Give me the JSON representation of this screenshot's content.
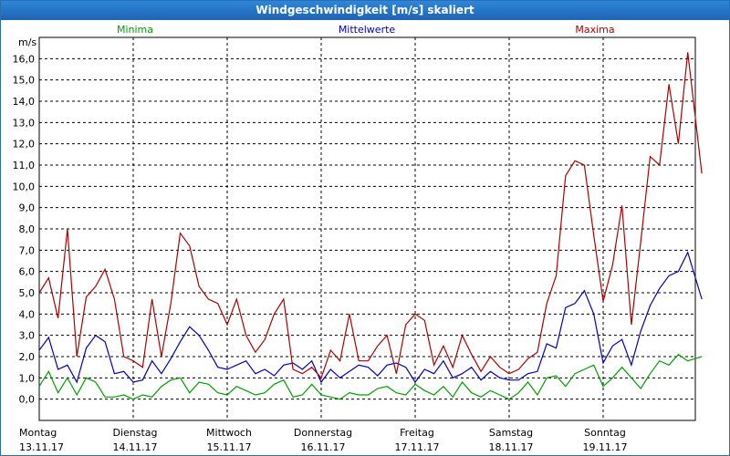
{
  "window": {
    "title": "Windgeschwindigkeit [m/s] skaliert"
  },
  "chart_data": {
    "type": "line",
    "ylabel": "m/s",
    "ylim": [
      -1,
      17
    ],
    "yticks": [
      "0,0",
      "1,0",
      "2,0",
      "3,0",
      "4,0",
      "5,0",
      "6,0",
      "7,0",
      "8,0",
      "9,0",
      "10,0",
      "11,0",
      "12,0",
      "13,0",
      "14,0",
      "15,0",
      "16,0"
    ],
    "grid": true,
    "legend_position": "top",
    "days": [
      {
        "name": "Montag",
        "date": "13.11.17"
      },
      {
        "name": "Dienstag",
        "date": "14.11.17"
      },
      {
        "name": "Mittwoch",
        "date": "15.11.17"
      },
      {
        "name": "Donnerstag",
        "date": "16.11.17"
      },
      {
        "name": "Freitag",
        "date": "17.11.17"
      },
      {
        "name": "Samstag",
        "date": "18.11.17"
      },
      {
        "name": "Sonntag",
        "date": "19.11.17"
      }
    ],
    "x_days": [
      0,
      0.1,
      0.2,
      0.3,
      0.4,
      0.5,
      0.6,
      0.7,
      0.8,
      0.9,
      1,
      1.1,
      1.2,
      1.3,
      1.4,
      1.5,
      1.6,
      1.7,
      1.8,
      1.9,
      2,
      2.1,
      2.2,
      2.3,
      2.4,
      2.5,
      2.6,
      2.7,
      2.8,
      2.9,
      3,
      3.1,
      3.2,
      3.3,
      3.4,
      3.5,
      3.6,
      3.7,
      3.8,
      3.9,
      4,
      4.1,
      4.2,
      4.3,
      4.4,
      4.5,
      4.6,
      4.7,
      4.8,
      4.9,
      5,
      5.1,
      5.2,
      5.3,
      5.4,
      5.5,
      5.6,
      5.7,
      5.8,
      5.9,
      6,
      6.1,
      6.2,
      6.3,
      6.4,
      6.5,
      6.6,
      6.7,
      6.8,
      6.9,
      7.05
    ],
    "series": [
      {
        "name": "Minima",
        "color": "#00a000",
        "values": [
          0.6,
          1.3,
          0.3,
          1.0,
          0.2,
          1.0,
          0.8,
          0.1,
          0.1,
          0.2,
          0.0,
          0.2,
          0.1,
          0.6,
          0.9,
          1.0,
          0.3,
          0.8,
          0.7,
          0.3,
          0.2,
          0.6,
          0.4,
          0.2,
          0.3,
          0.7,
          0.9,
          0.1,
          0.2,
          0.7,
          0.2,
          0.1,
          0.0,
          0.3,
          0.2,
          0.2,
          0.5,
          0.6,
          0.3,
          0.2,
          0.7,
          0.4,
          0.2,
          0.6,
          0.1,
          0.8,
          0.3,
          0.1,
          0.4,
          0.2,
          0.0,
          0.3,
          0.8,
          0.2,
          1.0,
          1.1,
          0.6,
          1.2,
          1.4,
          1.6,
          0.6,
          1.0,
          1.5,
          1.0,
          0.5,
          1.2,
          1.8,
          1.6,
          2.1,
          1.8,
          2.0
        ]
      },
      {
        "name": "Mittelwerte",
        "color": "#0000c0",
        "values": [
          2.3,
          2.9,
          1.4,
          1.6,
          0.8,
          2.4,
          3.0,
          2.7,
          1.2,
          1.3,
          0.8,
          0.9,
          1.8,
          1.2,
          1.9,
          2.7,
          3.4,
          3.0,
          2.3,
          1.5,
          1.4,
          1.6,
          1.8,
          1.2,
          1.4,
          1.1,
          1.6,
          1.7,
          1.4,
          1.8,
          0.8,
          1.4,
          1.0,
          1.3,
          1.6,
          1.5,
          1.1,
          1.6,
          1.7,
          1.5,
          0.8,
          1.4,
          1.2,
          1.8,
          1.0,
          1.2,
          1.5,
          0.9,
          1.3,
          1.0,
          0.9,
          0.9,
          1.2,
          1.3,
          2.6,
          2.4,
          4.3,
          4.5,
          5.1,
          4.0,
          1.7,
          2.5,
          2.8,
          1.6,
          3.2,
          4.4,
          5.2,
          5.8,
          6.0,
          6.9,
          4.7
        ]
      },
      {
        "name": "Maxima",
        "color": "#b00000",
        "values": [
          5.0,
          5.7,
          3.8,
          8.0,
          2.0,
          4.8,
          5.3,
          6.1,
          4.7,
          2.0,
          1.8,
          1.5,
          4.7,
          2.0,
          4.5,
          7.8,
          7.2,
          5.3,
          4.7,
          4.5,
          3.5,
          4.7,
          3.0,
          2.2,
          2.8,
          4.0,
          4.7,
          1.4,
          1.2,
          1.5,
          1.0,
          2.3,
          1.8,
          4.0,
          1.8,
          1.8,
          2.5,
          3.0,
          1.2,
          3.5,
          4.0,
          3.7,
          1.6,
          2.5,
          1.5,
          3.0,
          2.1,
          1.3,
          2.0,
          1.5,
          1.2,
          1.4,
          1.9,
          2.2,
          4.5,
          5.8,
          10.5,
          11.2,
          11.0,
          7.7,
          4.6,
          6.3,
          9.1,
          3.5,
          7.4,
          11.4,
          11.0,
          14.8,
          12.0,
          16.3,
          10.6
        ]
      }
    ]
  }
}
